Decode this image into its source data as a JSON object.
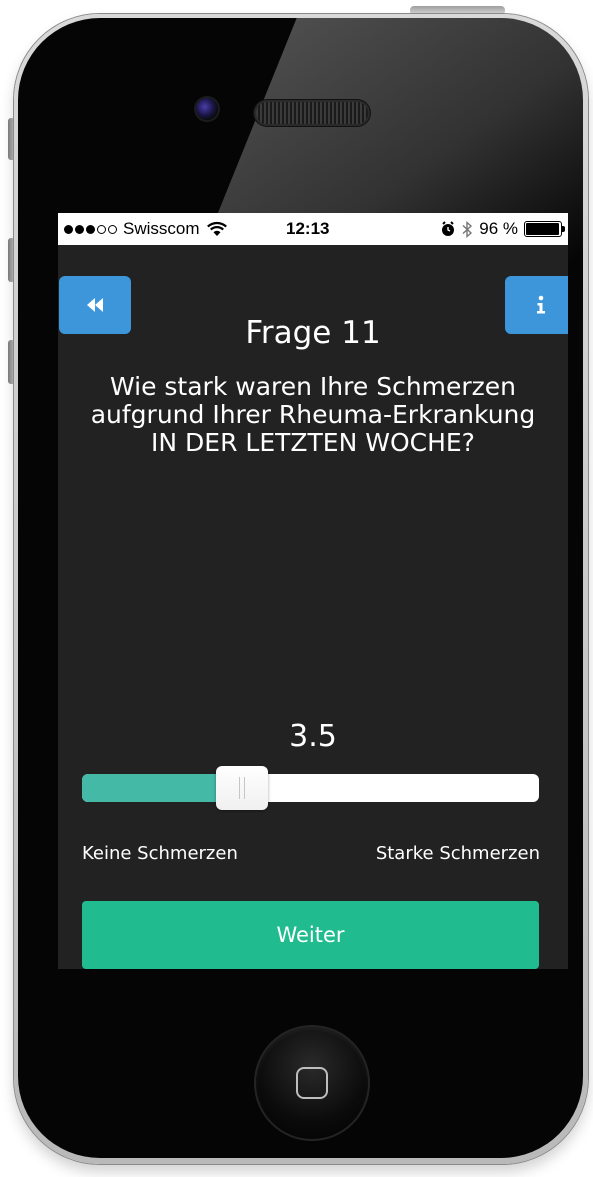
{
  "status_bar": {
    "carrier": "Swisscom",
    "time": "12:13",
    "battery": "96 %",
    "battery_level": 0.96,
    "signal_bars_filled": 3,
    "signal_bars_total": 5,
    "icons": [
      "wifi-icon",
      "alarm-icon",
      "bluetooth-icon",
      "battery-icon"
    ]
  },
  "navigation": {
    "back_icon": "rewind-icon",
    "info_icon": "info-icon"
  },
  "question": {
    "title": "Frage 11",
    "text": "Wie stark waren Ihre Schmerzen aufgrund Ihrer Rheuma-Erkrankung IN DER LETZTEN WOCHE?"
  },
  "slider": {
    "value_label": "3.5",
    "value": 3.5,
    "min": 0,
    "max": 10,
    "min_label": "Keine Schmerzen",
    "max_label": "Starke Schmerzen"
  },
  "actions": {
    "next_label": "Weiter"
  },
  "colors": {
    "screen_background": "#222222",
    "nav_button": "#3d96d9",
    "slider_fill": "#43b9a6",
    "next_button": "#20bc8f"
  }
}
